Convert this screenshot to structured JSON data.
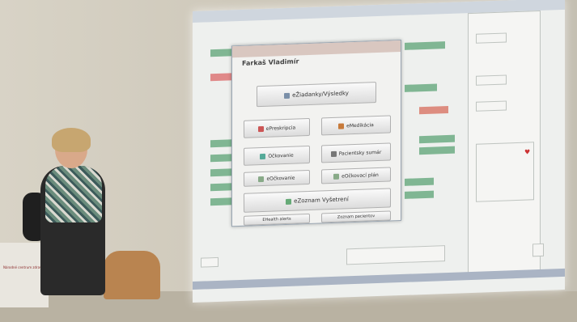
{
  "dialog": {
    "title": "Farkaš Vladimír",
    "buttons": {
      "results": "eŽiadanky/Výsledky",
      "prescription": "ePreskripcia",
      "medication": "eMedikácia",
      "vaccination": "Očkovanie",
      "patient_summary": "Pacientsky sumár",
      "odkrovenie": "eOčkovanie",
      "odkrovenie_plan": "eOčkovací plán",
      "exam": "eZoznam Vyšetrení",
      "bottom_left": "EHealth alerts",
      "bottom_right": "Zoznam pacientov"
    }
  },
  "podium": {
    "sign_text": "Národné centrum zdravotníckych informácií"
  }
}
